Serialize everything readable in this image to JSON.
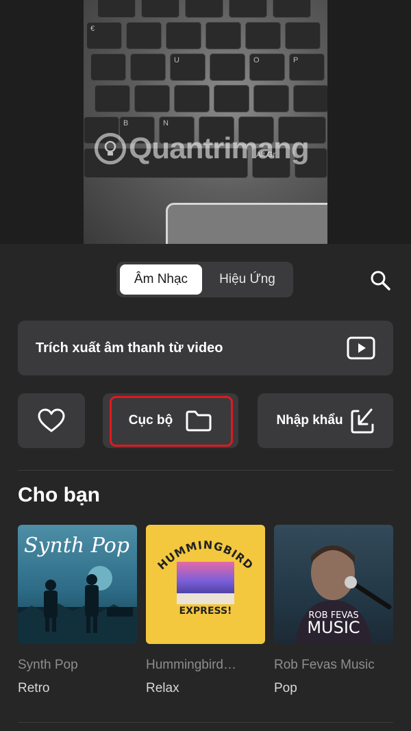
{
  "preview": {
    "watermark": "Quantrimang",
    "keys": [
      "€",
      "U",
      "O",
      "P",
      "B",
      "N",
      "Alt Gr"
    ]
  },
  "tabs": [
    {
      "label": "Âm Nhạc",
      "active": true
    },
    {
      "label": "Hiệu Ứng",
      "active": false
    }
  ],
  "search": {
    "icon": "search-icon"
  },
  "extract": {
    "label": "Trích xuất âm thanh từ video",
    "icon": "play-square-icon"
  },
  "quick_actions": {
    "favorite": {
      "icon": "heart-icon"
    },
    "local": {
      "label": "Cục bộ",
      "icon": "folder-icon"
    },
    "import": {
      "label": "Nhập khẩu",
      "icon": "import-icon"
    }
  },
  "highlight_color": "#e0191f",
  "section": {
    "title": "Cho bạn"
  },
  "albums": [
    {
      "title": "Synth Pop",
      "genre": "Retro",
      "cover_text": "Synth Pop"
    },
    {
      "title": "Hummingbird…",
      "genre": "Relax",
      "cover_text_top": "HUMMINGBIRD",
      "cover_text_bottom": "EXPRESS!"
    },
    {
      "title": "Rob Fevas Music",
      "genre": "Pop",
      "cover_text_top": "ROB FEVAS",
      "cover_text_bottom": "MUSIC"
    }
  ]
}
